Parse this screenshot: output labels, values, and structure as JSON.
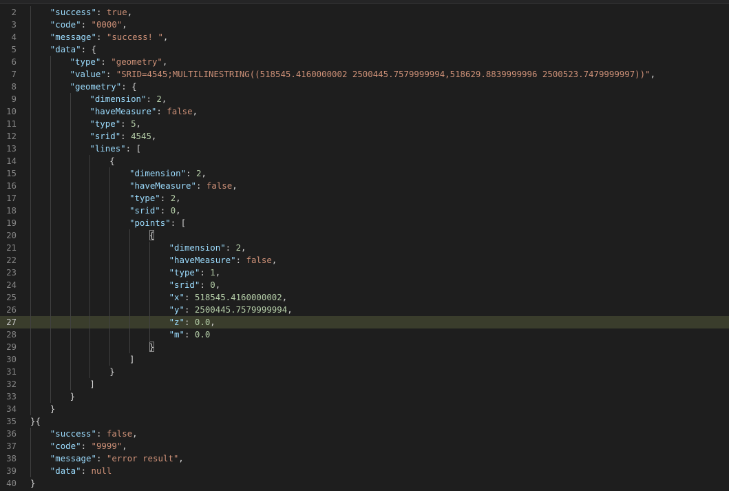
{
  "editor": {
    "first_line_number": 2,
    "highlighted_line": 27,
    "lines": [
      {
        "n": "2",
        "indent": 1,
        "tokens": [
          [
            "k",
            "\"success\""
          ],
          [
            "p",
            ": "
          ],
          [
            "b",
            "true"
          ],
          [
            "p",
            ","
          ]
        ]
      },
      {
        "n": "3",
        "indent": 1,
        "tokens": [
          [
            "k",
            "\"code\""
          ],
          [
            "p",
            ": "
          ],
          [
            "s",
            "\"0000\""
          ],
          [
            "p",
            ","
          ]
        ]
      },
      {
        "n": "4",
        "indent": 1,
        "tokens": [
          [
            "k",
            "\"message\""
          ],
          [
            "p",
            ": "
          ],
          [
            "s",
            "\"success! \""
          ],
          [
            "p",
            ","
          ]
        ]
      },
      {
        "n": "5",
        "indent": 1,
        "tokens": [
          [
            "k",
            "\"data\""
          ],
          [
            "p",
            ": {"
          ]
        ]
      },
      {
        "n": "6",
        "indent": 2,
        "tokens": [
          [
            "k",
            "\"type\""
          ],
          [
            "p",
            ": "
          ],
          [
            "s",
            "\"geometry\""
          ],
          [
            "p",
            ","
          ]
        ]
      },
      {
        "n": "7",
        "indent": 2,
        "tokens": [
          [
            "k",
            "\"value\""
          ],
          [
            "p",
            ": "
          ],
          [
            "s",
            "\"SRID=4545;MULTILINESTRING((518545.4160000002 2500445.7579999994,518629.8839999996 2500523.7479999997))\""
          ],
          [
            "p",
            ","
          ]
        ]
      },
      {
        "n": "8",
        "indent": 2,
        "tokens": [
          [
            "k",
            "\"geometry\""
          ],
          [
            "p",
            ": {"
          ]
        ]
      },
      {
        "n": "9",
        "indent": 3,
        "tokens": [
          [
            "k",
            "\"dimension\""
          ],
          [
            "p",
            ": "
          ],
          [
            "n",
            "2"
          ],
          [
            "p",
            ","
          ]
        ]
      },
      {
        "n": "10",
        "indent": 3,
        "tokens": [
          [
            "k",
            "\"haveMeasure\""
          ],
          [
            "p",
            ": "
          ],
          [
            "b",
            "false"
          ],
          [
            "p",
            ","
          ]
        ]
      },
      {
        "n": "11",
        "indent": 3,
        "tokens": [
          [
            "k",
            "\"type\""
          ],
          [
            "p",
            ": "
          ],
          [
            "n",
            "5"
          ],
          [
            "p",
            ","
          ]
        ]
      },
      {
        "n": "12",
        "indent": 3,
        "tokens": [
          [
            "k",
            "\"srid\""
          ],
          [
            "p",
            ": "
          ],
          [
            "n",
            "4545"
          ],
          [
            "p",
            ","
          ]
        ]
      },
      {
        "n": "13",
        "indent": 3,
        "tokens": [
          [
            "k",
            "\"lines\""
          ],
          [
            "p",
            ": ["
          ]
        ]
      },
      {
        "n": "14",
        "indent": 4,
        "tokens": [
          [
            "p",
            "{"
          ]
        ]
      },
      {
        "n": "15",
        "indent": 5,
        "tokens": [
          [
            "k",
            "\"dimension\""
          ],
          [
            "p",
            ": "
          ],
          [
            "n",
            "2"
          ],
          [
            "p",
            ","
          ]
        ]
      },
      {
        "n": "16",
        "indent": 5,
        "tokens": [
          [
            "k",
            "\"haveMeasure\""
          ],
          [
            "p",
            ": "
          ],
          [
            "b",
            "false"
          ],
          [
            "p",
            ","
          ]
        ]
      },
      {
        "n": "17",
        "indent": 5,
        "tokens": [
          [
            "k",
            "\"type\""
          ],
          [
            "p",
            ": "
          ],
          [
            "n",
            "2"
          ],
          [
            "p",
            ","
          ]
        ]
      },
      {
        "n": "18",
        "indent": 5,
        "tokens": [
          [
            "k",
            "\"srid\""
          ],
          [
            "p",
            ": "
          ],
          [
            "n",
            "0"
          ],
          [
            "p",
            ","
          ]
        ]
      },
      {
        "n": "19",
        "indent": 5,
        "tokens": [
          [
            "k",
            "\"points\""
          ],
          [
            "p",
            ": ["
          ]
        ]
      },
      {
        "n": "20",
        "indent": 6,
        "tokens": [
          [
            "bm",
            "{"
          ]
        ]
      },
      {
        "n": "21",
        "indent": 7,
        "tokens": [
          [
            "k",
            "\"dimension\""
          ],
          [
            "p",
            ": "
          ],
          [
            "n",
            "2"
          ],
          [
            "p",
            ","
          ]
        ]
      },
      {
        "n": "22",
        "indent": 7,
        "tokens": [
          [
            "k",
            "\"haveMeasure\""
          ],
          [
            "p",
            ": "
          ],
          [
            "b",
            "false"
          ],
          [
            "p",
            ","
          ]
        ]
      },
      {
        "n": "23",
        "indent": 7,
        "tokens": [
          [
            "k",
            "\"type\""
          ],
          [
            "p",
            ": "
          ],
          [
            "n",
            "1"
          ],
          [
            "p",
            ","
          ]
        ]
      },
      {
        "n": "24",
        "indent": 7,
        "tokens": [
          [
            "k",
            "\"srid\""
          ],
          [
            "p",
            ": "
          ],
          [
            "n",
            "0"
          ],
          [
            "p",
            ","
          ]
        ]
      },
      {
        "n": "25",
        "indent": 7,
        "tokens": [
          [
            "k",
            "\"x\""
          ],
          [
            "p",
            ": "
          ],
          [
            "n",
            "518545.4160000002"
          ],
          [
            "p",
            ","
          ]
        ]
      },
      {
        "n": "26",
        "indent": 7,
        "tokens": [
          [
            "k",
            "\"y\""
          ],
          [
            "p",
            ": "
          ],
          [
            "n",
            "2500445.7579999994"
          ],
          [
            "p",
            ","
          ]
        ]
      },
      {
        "n": "27",
        "indent": 7,
        "tokens": [
          [
            "k",
            "\"z\""
          ],
          [
            "p",
            ": "
          ],
          [
            "n",
            "0.0"
          ],
          [
            "p",
            ","
          ]
        ]
      },
      {
        "n": "28",
        "indent": 7,
        "tokens": [
          [
            "k",
            "\"m\""
          ],
          [
            "p",
            ": "
          ],
          [
            "n",
            "0.0"
          ]
        ]
      },
      {
        "n": "29",
        "indent": 6,
        "tokens": [
          [
            "bm",
            "}"
          ]
        ]
      },
      {
        "n": "30",
        "indent": 5,
        "tokens": [
          [
            "p",
            "]"
          ]
        ]
      },
      {
        "n": "31",
        "indent": 4,
        "tokens": [
          [
            "p",
            "}"
          ]
        ]
      },
      {
        "n": "32",
        "indent": 3,
        "tokens": [
          [
            "p",
            "]"
          ]
        ]
      },
      {
        "n": "33",
        "indent": 2,
        "tokens": [
          [
            "p",
            "}"
          ]
        ]
      },
      {
        "n": "34",
        "indent": 1,
        "tokens": [
          [
            "p",
            "}"
          ]
        ]
      },
      {
        "n": "35",
        "indent": 0,
        "tokens": [
          [
            "p",
            "}{"
          ]
        ]
      },
      {
        "n": "36",
        "indent": 1,
        "tokens": [
          [
            "k",
            "\"success\""
          ],
          [
            "p",
            ": "
          ],
          [
            "b",
            "false"
          ],
          [
            "p",
            ","
          ]
        ]
      },
      {
        "n": "37",
        "indent": 1,
        "tokens": [
          [
            "k",
            "\"code\""
          ],
          [
            "p",
            ": "
          ],
          [
            "s",
            "\"9999\""
          ],
          [
            "p",
            ","
          ]
        ]
      },
      {
        "n": "38",
        "indent": 1,
        "tokens": [
          [
            "k",
            "\"message\""
          ],
          [
            "p",
            ": "
          ],
          [
            "s",
            "\"error result\""
          ],
          [
            "p",
            ","
          ]
        ]
      },
      {
        "n": "39",
        "indent": 1,
        "tokens": [
          [
            "k",
            "\"data\""
          ],
          [
            "p",
            ": "
          ],
          [
            "b",
            "null"
          ]
        ]
      },
      {
        "n": "40",
        "indent": 0,
        "tokens": [
          [
            "p",
            "}"
          ]
        ]
      }
    ]
  },
  "colors": {
    "background": "#1e1e1e",
    "key": "#9cdcfe",
    "string": "#ce9178",
    "number": "#b5cea8",
    "punctuation": "#d4d4d4",
    "line_number": "#858585",
    "highlight": "#3a3d2c"
  }
}
